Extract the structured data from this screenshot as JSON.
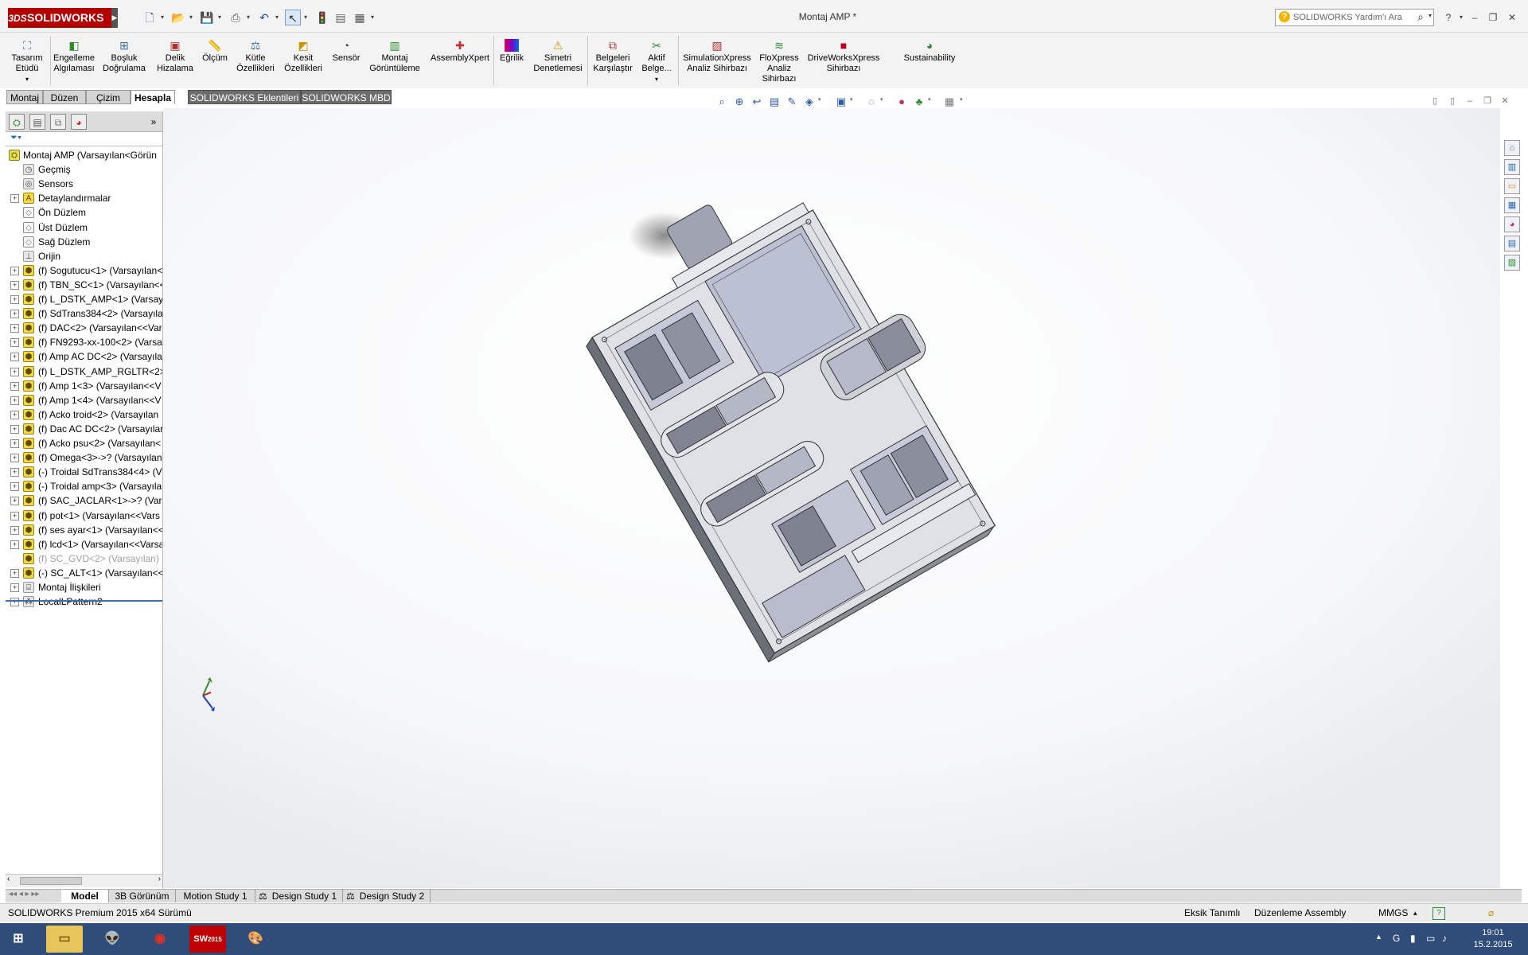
{
  "app": {
    "logo": "SOLIDWORKS",
    "title": "Montaj AMP *",
    "search_placeholder": "SOLIDWORKS Yardım'ı Ara"
  },
  "ribbon": [
    {
      "id": "tasarim-etudu",
      "label1": "Tasarım",
      "label2": "Etüdü",
      "icon": "design-study-icon"
    },
    {
      "id": "engelleme",
      "label1": "Engelleme",
      "label2": "Algılaması",
      "icon": "interference-icon"
    },
    {
      "id": "bosluk",
      "label1": "Boşluk",
      "label2": "Doğrulama",
      "icon": "clearance-icon"
    },
    {
      "id": "delik",
      "label1": "Delik",
      "label2": "Hizalama",
      "icon": "hole-align-icon"
    },
    {
      "id": "olcum",
      "label1": "Ölçüm",
      "label2": "",
      "icon": "measure-icon"
    },
    {
      "id": "kutle",
      "label1": "Kütle",
      "label2": "Özellikleri",
      "icon": "mass-props-icon"
    },
    {
      "id": "kesit",
      "label1": "Kesit",
      "label2": "Özellikleri",
      "icon": "section-props-icon"
    },
    {
      "id": "sensor",
      "label1": "Sensör",
      "label2": "",
      "icon": "sensor-icon"
    },
    {
      "id": "montaj-goruntuleme",
      "label1": "Montaj",
      "label2": "Görüntüleme",
      "icon": "assembly-visualization-icon"
    },
    {
      "id": "assemblyxpert",
      "label1": "AssemblyXpert",
      "label2": "",
      "icon": "assemblyxpert-icon"
    },
    {
      "id": "egrilik",
      "label1": "Eğrilik",
      "label2": "",
      "icon": "curvature-icon"
    },
    {
      "id": "simetri",
      "label1": "Simetri",
      "label2": "Denetlemesi",
      "icon": "symmetry-icon"
    },
    {
      "id": "belgeleri",
      "label1": "Belgeleri",
      "label2": "Karşılaştır",
      "icon": "compare-icon"
    },
    {
      "id": "aktif-belge",
      "label1": "Aktif",
      "label2": "Belge...",
      "icon": "active-doc-icon"
    },
    {
      "id": "simulationxpress",
      "label1": "SimulationXpress",
      "label2": "Analiz Sihirbazı",
      "icon": "simulation-icon"
    },
    {
      "id": "floxpress",
      "label1": "FloXpress",
      "label2": "Analiz",
      "label3": "Sihirbazı",
      "icon": "floxpress-icon"
    },
    {
      "id": "driveworks",
      "label1": "DriveWorksXpress",
      "label2": "Sihirbazı",
      "icon": "driveworks-icon"
    },
    {
      "id": "sustainability",
      "label1": "Sustainability",
      "label2": "",
      "icon": "sustainability-icon"
    }
  ],
  "tabs": [
    "Montaj",
    "Düzen",
    "Çizim",
    "Hesapla",
    "SOLIDWORKS Eklentileri",
    "SOLIDWORKS MBD"
  ],
  "active_tab": "Hesapla",
  "tree": [
    {
      "label": "Montaj AMP  (Varsayılan<Görün",
      "icon": "assembly-icon",
      "expand": false,
      "indent": 0
    },
    {
      "label": "Geçmiş",
      "icon": "history-icon",
      "expand": false,
      "indent": 1
    },
    {
      "label": "Sensors",
      "icon": "sensors-icon",
      "expand": false,
      "indent": 1
    },
    {
      "label": "Detaylandırmalar",
      "icon": "annotations-icon",
      "expand": true,
      "indent": 1
    },
    {
      "label": "Ön Düzlem",
      "icon": "plane-icon",
      "expand": false,
      "indent": 1
    },
    {
      "label": "Üst Düzlem",
      "icon": "plane-icon",
      "expand": false,
      "indent": 1
    },
    {
      "label": "Sağ Düzlem",
      "icon": "plane-icon",
      "expand": false,
      "indent": 1
    },
    {
      "label": "Orijin",
      "icon": "origin-icon",
      "expand": false,
      "indent": 1
    },
    {
      "label": "(f) Sogutucu<1> (Varsayılan<",
      "icon": "part-icon",
      "expand": true,
      "indent": 1
    },
    {
      "label": "(f) TBN_SC<1> (Varsayılan<<",
      "icon": "part-icon",
      "expand": true,
      "indent": 1
    },
    {
      "label": "(f) L_DSTK_AMP<1> (Varsayıl",
      "icon": "part-icon",
      "expand": true,
      "indent": 1
    },
    {
      "label": "(f) SdTrans384<2> (Varsayılar",
      "icon": "part-icon",
      "expand": true,
      "indent": 1
    },
    {
      "label": "(f) DAC<2> (Varsayılan<<Var",
      "icon": "part-icon",
      "expand": true,
      "indent": 1
    },
    {
      "label": "(f) FN9293-xx-100<2> (Varsay",
      "icon": "part-icon",
      "expand": true,
      "indent": 1
    },
    {
      "label": "(f) Amp AC DC<2> (Varsayıla",
      "icon": "part-icon",
      "expand": true,
      "indent": 1
    },
    {
      "label": "(f) L_DSTK_AMP_RGLTR<2> (",
      "icon": "part-icon",
      "expand": true,
      "indent": 1
    },
    {
      "label": "(f) Amp 1<3> (Varsayılan<<V",
      "icon": "part-icon",
      "expand": true,
      "indent": 1
    },
    {
      "label": "(f) Amp 1<4> (Varsayılan<<V",
      "icon": "part-icon",
      "expand": true,
      "indent": 1
    },
    {
      "label": "(f) Acko troid<2> (Varsayılan",
      "icon": "part-icon",
      "expand": true,
      "indent": 1
    },
    {
      "label": "(f) Dac AC DC<2> (Varsayılar",
      "icon": "part-icon",
      "expand": true,
      "indent": 1
    },
    {
      "label": "(f) Acko psu<2> (Varsayılan<",
      "icon": "part-icon",
      "expand": true,
      "indent": 1
    },
    {
      "label": "(f) Omega<3>->? (Varsayılan",
      "icon": "part-icon",
      "expand": true,
      "indent": 1
    },
    {
      "label": "(-) Troidal SdTrans384<4> (V",
      "icon": "part-icon",
      "expand": true,
      "indent": 1
    },
    {
      "label": "(-) Troidal amp<3> (Varsayıla",
      "icon": "part-icon",
      "expand": true,
      "indent": 1
    },
    {
      "label": "(f) SAC_JACLAR<1>->? (Vars",
      "icon": "part-icon",
      "expand": true,
      "indent": 1
    },
    {
      "label": "(f) pot<1> (Varsayılan<<Vars",
      "icon": "part-icon",
      "expand": true,
      "indent": 1
    },
    {
      "label": "(f) ses ayar<1> (Varsayılan<<",
      "icon": "part-icon",
      "expand": true,
      "indent": 1
    },
    {
      "label": "(f) lcd<1> (Varsayılan<<Varsa",
      "icon": "part-icon",
      "expand": true,
      "indent": 1
    },
    {
      "label": "(f) SC_GVD<2> (Varsayılan)",
      "icon": "part-icon",
      "expand": false,
      "indent": 1,
      "dim": true
    },
    {
      "label": "(-) SC_ALT<1> (Varsayılan<<",
      "icon": "part-icon",
      "expand": true,
      "indent": 1
    },
    {
      "label": "Montaj İlişkileri",
      "icon": "mates-icon",
      "expand": true,
      "indent": 1
    },
    {
      "label": "LocalLPattern2",
      "icon": "pattern-icon",
      "expand": true,
      "indent": 1
    }
  ],
  "bottom_tabs": [
    "Model",
    "3B Görünüm",
    "Motion Study 1",
    "Design Study 1",
    "Design Study 2"
  ],
  "active_bottom_tab": "Model",
  "status": {
    "version": "SOLIDWORKS Premium 2015 x64 Sürümü",
    "definition": "Eksik Tanımlı",
    "mode": "Düzenleme Assembly",
    "units": "MMGS"
  },
  "taskbar": {
    "apps": [
      "start-icon",
      "file-explorer-icon",
      "alien-app-icon",
      "chrome-icon",
      "solidworks-2015-icon",
      "paint-icon"
    ],
    "sw_badge": "2015",
    "time": "19:01",
    "date": "15.2.2015"
  },
  "colors": {
    "brand": "#b40000",
    "taskbar": "#304c78",
    "part_icon": "#f3d84e"
  }
}
